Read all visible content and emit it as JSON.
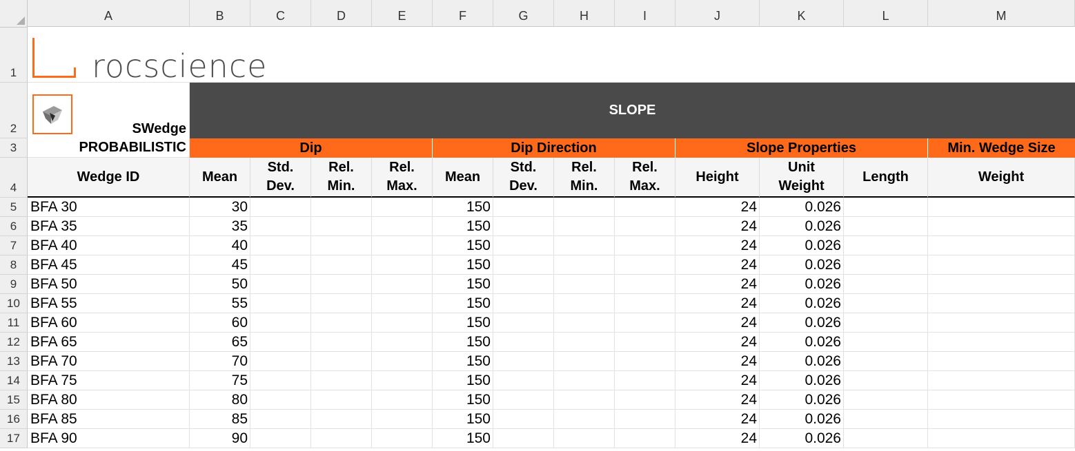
{
  "columns": [
    "A",
    "B",
    "C",
    "D",
    "E",
    "F",
    "G",
    "H",
    "I",
    "J",
    "K",
    "L",
    "M"
  ],
  "rows": [
    "1",
    "2",
    "3",
    "4",
    "5",
    "6",
    "7",
    "8",
    "9",
    "10",
    "11",
    "12",
    "13",
    "14",
    "15",
    "16",
    "17"
  ],
  "logo": {
    "text": "rocscience",
    "accent_color": "#ff6a1a"
  },
  "app_label": "SWedge",
  "mode_label": "PROBABILISTIC",
  "banner": "SLOPE",
  "groups": [
    "Dip",
    "Dip Direction",
    "Slope Properties",
    "Min. Wedge Size"
  ],
  "subheaders": {
    "wedge_id": "Wedge ID",
    "dip_mean": "Mean",
    "dip_std": "Std.\nDev.",
    "dip_relmin": "Rel.\nMin.",
    "dip_relmax": "Rel.\nMax.",
    "dd_mean": "Mean",
    "dd_std": "Std.\nDev.",
    "dd_relmin": "Rel.\nMin.",
    "dd_relmax": "Rel.\nMax.",
    "height": "Height",
    "unit_weight": "Unit\nWeight",
    "length": "Length",
    "weight": "Weight"
  },
  "table": [
    {
      "id": "BFA 30",
      "dip": "30",
      "dipdir": "150",
      "height": "24",
      "unit_weight": "0.026"
    },
    {
      "id": "BFA 35",
      "dip": "35",
      "dipdir": "150",
      "height": "24",
      "unit_weight": "0.026"
    },
    {
      "id": "BFA 40",
      "dip": "40",
      "dipdir": "150",
      "height": "24",
      "unit_weight": "0.026"
    },
    {
      "id": "BFA 45",
      "dip": "45",
      "dipdir": "150",
      "height": "24",
      "unit_weight": "0.026"
    },
    {
      "id": "BFA 50",
      "dip": "50",
      "dipdir": "150",
      "height": "24",
      "unit_weight": "0.026"
    },
    {
      "id": "BFA 55",
      "dip": "55",
      "dipdir": "150",
      "height": "24",
      "unit_weight": "0.026"
    },
    {
      "id": "BFA 60",
      "dip": "60",
      "dipdir": "150",
      "height": "24",
      "unit_weight": "0.026"
    },
    {
      "id": "BFA 65",
      "dip": "65",
      "dipdir": "150",
      "height": "24",
      "unit_weight": "0.026"
    },
    {
      "id": "BFA 70",
      "dip": "70",
      "dipdir": "150",
      "height": "24",
      "unit_weight": "0.026"
    },
    {
      "id": "BFA 75",
      "dip": "75",
      "dipdir": "150",
      "height": "24",
      "unit_weight": "0.026"
    },
    {
      "id": "BFA 80",
      "dip": "80",
      "dipdir": "150",
      "height": "24",
      "unit_weight": "0.026"
    },
    {
      "id": "BFA 85",
      "dip": "85",
      "dipdir": "150",
      "height": "24",
      "unit_weight": "0.026"
    },
    {
      "id": "BFA 90",
      "dip": "90",
      "dipdir": "150",
      "height": "24",
      "unit_weight": "0.026"
    }
  ],
  "colors": {
    "accent": "#ff6a1a",
    "banner_bg": "#4a4a4a"
  }
}
